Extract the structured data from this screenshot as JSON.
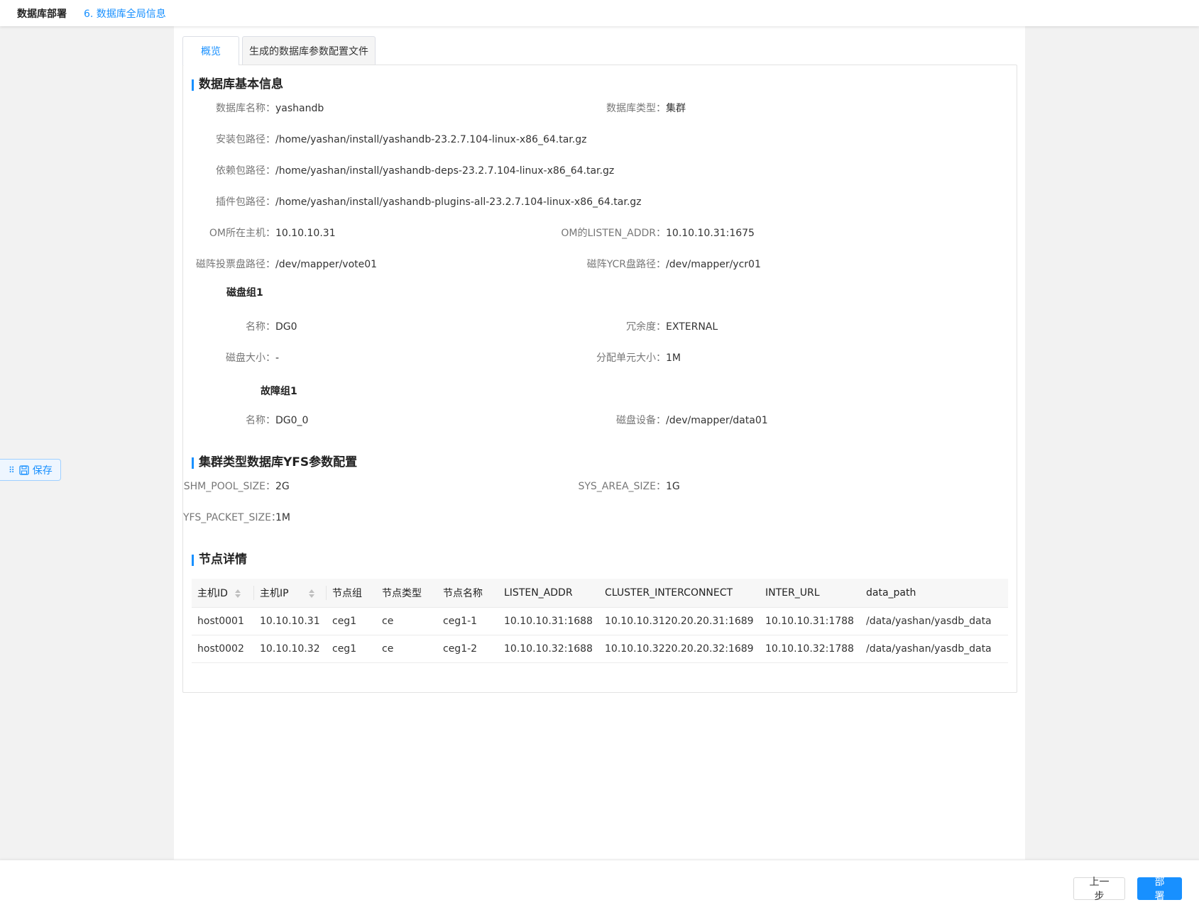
{
  "header": {
    "app_title": "数据库部署",
    "step_title": "6. 数据库全局信息"
  },
  "tabs": [
    {
      "label": "概览",
      "active": true
    },
    {
      "label": "生成的数据库参数配置文件",
      "active": false
    }
  ],
  "sections": {
    "basic": {
      "title": "数据库基本信息",
      "db_name": {
        "label": "数据库名称：",
        "value": "yashandb"
      },
      "db_type": {
        "label": "数据库类型：",
        "value": "集群"
      },
      "install_path": {
        "label": "安装包路径：",
        "value": "/home/yashan/install/yashandb-23.2.7.104-linux-x86_64.tar.gz"
      },
      "deps_path": {
        "label": "依赖包路径：",
        "value": "/home/yashan/install/yashandb-deps-23.2.7.104-linux-x86_64.tar.gz"
      },
      "plugin_path": {
        "label": "插件包路径：",
        "value": "/home/yashan/install/yashandb-plugins-all-23.2.7.104-linux-x86_64.tar.gz"
      },
      "om_host": {
        "label": "OM所在主机：",
        "value": "10.10.10.31"
      },
      "om_listen": {
        "label": "OM的LISTEN_ADDR：",
        "value": "10.10.10.31:1675"
      },
      "vote_path": {
        "label": "磁阵投票盘路径：",
        "value": "/dev/mapper/vote01"
      },
      "ycr_path": {
        "label": "磁阵YCR盘路径：",
        "value": "/dev/mapper/ycr01"
      },
      "disk_group": {
        "title": "磁盘组1",
        "name": {
          "label": "名称：",
          "value": "DG0"
        },
        "redundancy": {
          "label": "冗余度：",
          "value": "EXTERNAL"
        },
        "size": {
          "label": "磁盘大小：",
          "value": "-"
        },
        "au_size": {
          "label": "分配单元大小：",
          "value": "1M"
        },
        "failure_group": {
          "title": "故障组1",
          "name": {
            "label": "名称：",
            "value": "DG0_0"
          },
          "device": {
            "label": "磁盘设备：",
            "value": "/dev/mapper/data01"
          }
        }
      }
    },
    "yfs": {
      "title": "集群类型数据库YFS参数配置",
      "shm_pool": {
        "label": "SHM_POOL_SIZE：",
        "value": "2G"
      },
      "sys_area": {
        "label": "SYS_AREA_SIZE：",
        "value": "1G"
      },
      "packet": {
        "label": "YFS_PACKET_SIZE：",
        "value": "1M"
      }
    },
    "nodes": {
      "title": "节点详情",
      "columns": [
        "主机ID",
        "主机IP",
        "节点组",
        "节点类型",
        "节点名称",
        "LISTEN_ADDR",
        "CLUSTER_INTERCONNECT",
        "INTER_URL",
        "data_path"
      ],
      "rows": [
        [
          "host0001",
          "10.10.10.31",
          "ceg1",
          "ce",
          "ceg1-1",
          "10.10.10.31:1688",
          "10.10.10.3120.20.20.31:1689",
          "10.10.10.31:1788",
          "/data/yashan/yasdb_data"
        ],
        [
          "host0002",
          "10.10.10.32",
          "ceg1",
          "ce",
          "ceg1-2",
          "10.10.10.32:1688",
          "10.10.10.3220.20.20.32:1689",
          "10.10.10.32:1788",
          "/data/yashan/yasdb_data"
        ]
      ]
    }
  },
  "float_save": {
    "label": "保存",
    "icon": "save-icon"
  },
  "footer": {
    "prev_label": "上一步",
    "deploy_label": "部 署"
  },
  "colors": {
    "accent": "#1890ff"
  }
}
